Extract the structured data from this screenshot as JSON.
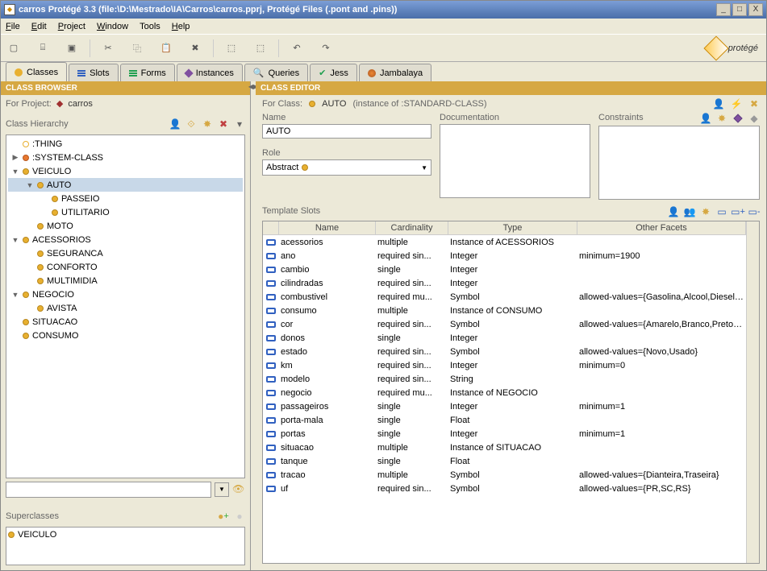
{
  "titlebar": {
    "title": "carros  Protégé 3.3    (file:\\D:\\Mestrado\\IA\\Carros\\carros.pprj, Protégé Files (.pont and .pins))"
  },
  "menu": {
    "file": "File",
    "edit": "Edit",
    "project": "Project",
    "window": "Window",
    "tools": "Tools",
    "help": "Help"
  },
  "logo": "protégé",
  "tabs": {
    "classes": "Classes",
    "slots": "Slots",
    "forms": "Forms",
    "instances": "Instances",
    "queries": "Queries",
    "jess": "Jess",
    "jambalaya": "Jambalaya"
  },
  "browser": {
    "title": "CLASS BROWSER",
    "for_label": "For Project:",
    "project": "carros",
    "hierarchy_label": "Class Hierarchy",
    "superclasses_label": "Superclasses",
    "superclass": "VEICULO",
    "tree": [
      {
        "d": 0,
        "exp": "",
        "b": "hollow",
        "t": ":THING"
      },
      {
        "d": 0,
        "exp": "▶",
        "b": "orange",
        "t": ":SYSTEM-CLASS"
      },
      {
        "d": 0,
        "exp": "▼",
        "b": "yellow",
        "t": "VEICULO"
      },
      {
        "d": 1,
        "exp": "▼",
        "b": "yellow",
        "t": "AUTO",
        "sel": true
      },
      {
        "d": 2,
        "exp": "",
        "b": "yellow",
        "t": "PASSEIO"
      },
      {
        "d": 2,
        "exp": "",
        "b": "yellow",
        "t": "UTILITARIO"
      },
      {
        "d": 1,
        "exp": "",
        "b": "yellow",
        "t": "MOTO"
      },
      {
        "d": 0,
        "exp": "▼",
        "b": "yellow",
        "t": "ACESSORIOS"
      },
      {
        "d": 1,
        "exp": "",
        "b": "yellow",
        "t": "SEGURANCA"
      },
      {
        "d": 1,
        "exp": "",
        "b": "yellow",
        "t": "CONFORTO"
      },
      {
        "d": 1,
        "exp": "",
        "b": "yellow",
        "t": "MULTIMIDIA"
      },
      {
        "d": 0,
        "exp": "▼",
        "b": "yellow",
        "t": "NEGOCIO"
      },
      {
        "d": 1,
        "exp": "",
        "b": "yellow",
        "t": "AVISTA"
      },
      {
        "d": 0,
        "exp": "",
        "b": "yellow",
        "t": "SITUACAO"
      },
      {
        "d": 0,
        "exp": "",
        "b": "yellow",
        "t": "CONSUMO"
      }
    ]
  },
  "editor": {
    "title": "CLASS EDITOR",
    "for_label": "For Class:",
    "class": "AUTO",
    "instance_of": "(instance of :STANDARD-CLASS)",
    "name_label": "Name",
    "name_value": "AUTO",
    "role_label": "Role",
    "role_value": "Abstract",
    "doc_label": "Documentation",
    "constraints_label": "Constraints",
    "slots_label": "Template Slots",
    "columns": {
      "name": "Name",
      "card": "Cardinality",
      "type": "Type",
      "other": "Other Facets"
    },
    "slots": [
      {
        "n": "acessorios",
        "c": "multiple",
        "t": "Instance of ACESSORIOS",
        "o": ""
      },
      {
        "n": "ano",
        "c": "required sin...",
        "t": "Integer",
        "o": "minimum=1900"
      },
      {
        "n": "cambio",
        "c": "single",
        "t": "Integer",
        "o": ""
      },
      {
        "n": "cilindradas",
        "c": "required sin...",
        "t": "Integer",
        "o": ""
      },
      {
        "n": "combustivel",
        "c": "required mu...",
        "t": "Symbol",
        "o": "allowed-values={Gasolina,Alcool,Diesel,Gas,Eletrico,H..."
      },
      {
        "n": "consumo",
        "c": "multiple",
        "t": "Instance of CONSUMO",
        "o": ""
      },
      {
        "n": "cor",
        "c": "required sin...",
        "t": "Symbol",
        "o": "allowed-values={Amarelo,Branco,Preto,Cinza,Azul,Ve..."
      },
      {
        "n": "donos",
        "c": "single",
        "t": "Integer",
        "o": ""
      },
      {
        "n": "estado",
        "c": "required sin...",
        "t": "Symbol",
        "o": "allowed-values={Novo,Usado}"
      },
      {
        "n": "km",
        "c": "required sin...",
        "t": "Integer",
        "o": "minimum=0"
      },
      {
        "n": "modelo",
        "c": "required sin...",
        "t": "String",
        "o": ""
      },
      {
        "n": "negocio",
        "c": "required mu...",
        "t": "Instance of NEGOCIO",
        "o": ""
      },
      {
        "n": "passageiros",
        "c": "single",
        "t": "Integer",
        "o": "minimum=1"
      },
      {
        "n": "porta-mala",
        "c": "single",
        "t": "Float",
        "o": ""
      },
      {
        "n": "portas",
        "c": "single",
        "t": "Integer",
        "o": "minimum=1"
      },
      {
        "n": "situacao",
        "c": "multiple",
        "t": "Instance of SITUACAO",
        "o": ""
      },
      {
        "n": "tanque",
        "c": "single",
        "t": "Float",
        "o": ""
      },
      {
        "n": "tracao",
        "c": "multiple",
        "t": "Symbol",
        "o": "allowed-values={Dianteira,Traseira}"
      },
      {
        "n": "uf",
        "c": "required sin...",
        "t": "Symbol",
        "o": "allowed-values={PR,SC,RS}"
      }
    ]
  }
}
